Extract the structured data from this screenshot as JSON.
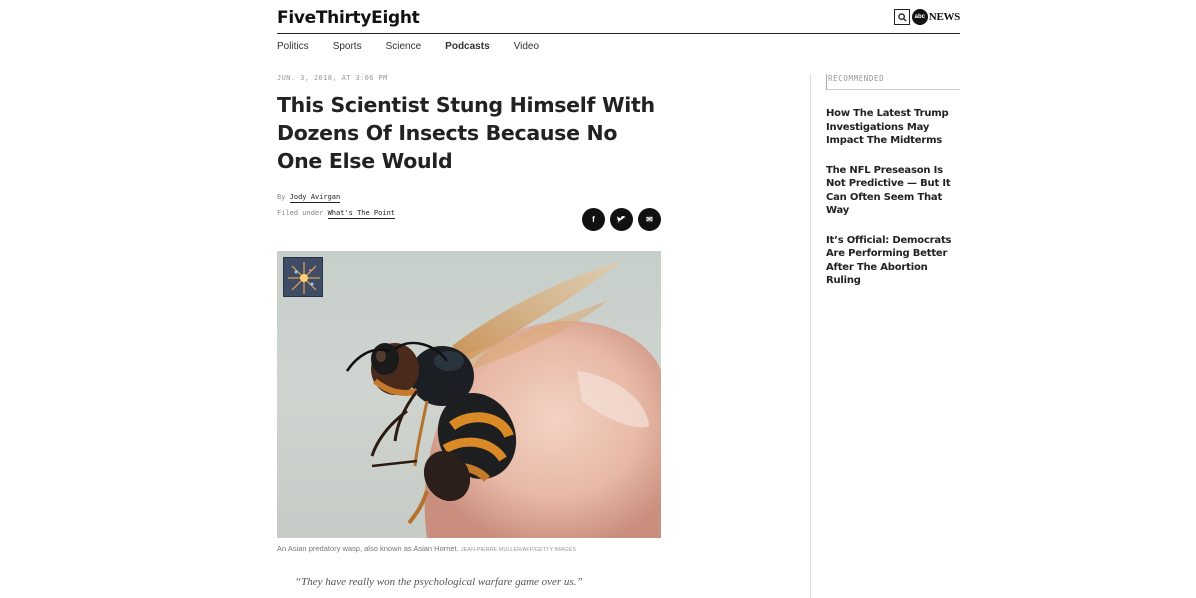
{
  "header": {
    "logo": "FiveThirtyEight",
    "abc_badge": "abc",
    "abc_news": "NEWS"
  },
  "nav": {
    "items": [
      {
        "label": "Politics"
      },
      {
        "label": "Sports"
      },
      {
        "label": "Science"
      },
      {
        "label": "Podcasts"
      },
      {
        "label": "Video"
      }
    ]
  },
  "article": {
    "dateline": "JUN. 3, 2018, AT 3:06 PM",
    "headline": "This Scientist Stung Himself With Dozens Of Insects Because No One Else Would",
    "by_prefix": "By",
    "author": "Jody Avirgan",
    "filed_prefix": "Filed under",
    "filed_topic": "What's The Point",
    "share": {
      "facebook": "f",
      "twitter": "t",
      "email": "✉"
    },
    "image_caption": "An Asian predatory wasp, also known as Asian Hornet.",
    "image_credit": "JEAN-PIERRE MULLER/AFP/GETTY IMAGES",
    "pull_quote": "“They have really won the psychological warfare game over us.”"
  },
  "rail": {
    "title": "RECOMMENDED",
    "items": [
      {
        "label": "How The Latest Trump Investigations May Impact The Midterms"
      },
      {
        "label": "The NFL Preseason Is Not Predictive — But It Can Often Seem That Way"
      },
      {
        "label": "It’s Official: Democrats Are Performing Better After The Abortion Ruling"
      }
    ]
  },
  "colors": {
    "text": "#222222",
    "muted": "#999999",
    "share_button": "#111111"
  }
}
